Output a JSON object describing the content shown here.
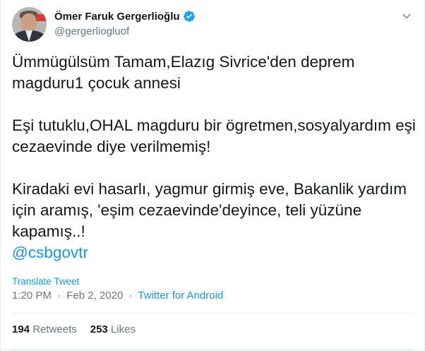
{
  "author": {
    "name": "Ömer Faruk Gergerlioğlu",
    "handle": "@gergerliogluof"
  },
  "tweet": {
    "body": "Ümmügülsüm Tamam,Elazıg Sivrice'den deprem\nmagduru1 çocuk annesi\n\nEşi tutuklu,OHAL magduru bir ögretmen,sosyalyardım eşi\ncezaevinde diye verilmemiş!\n\nKiradaki evi hasarlı, yagmur girmiş eve, Bakanlik yardım\niçin aramış, 'eşim cezaevinde'deyince, teli yüzüne\nkapamış..!",
    "mention": "@csbgovtr",
    "translate_label": "Translate Tweet",
    "time": "1:20 PM",
    "date": "Feb 2, 2020",
    "separator": "·",
    "source": "Twitter for Android"
  },
  "stats": {
    "retweets_count": "194",
    "retweets_label": "Retweets",
    "likes_count": "253",
    "likes_label": "Likes"
  },
  "colors": {
    "link": "#1b95e0",
    "secondary": "#657786",
    "verified": "#1da1f2"
  },
  "icons": {
    "verified": "verified-badge-icon",
    "more": "chevron-down-icon"
  }
}
